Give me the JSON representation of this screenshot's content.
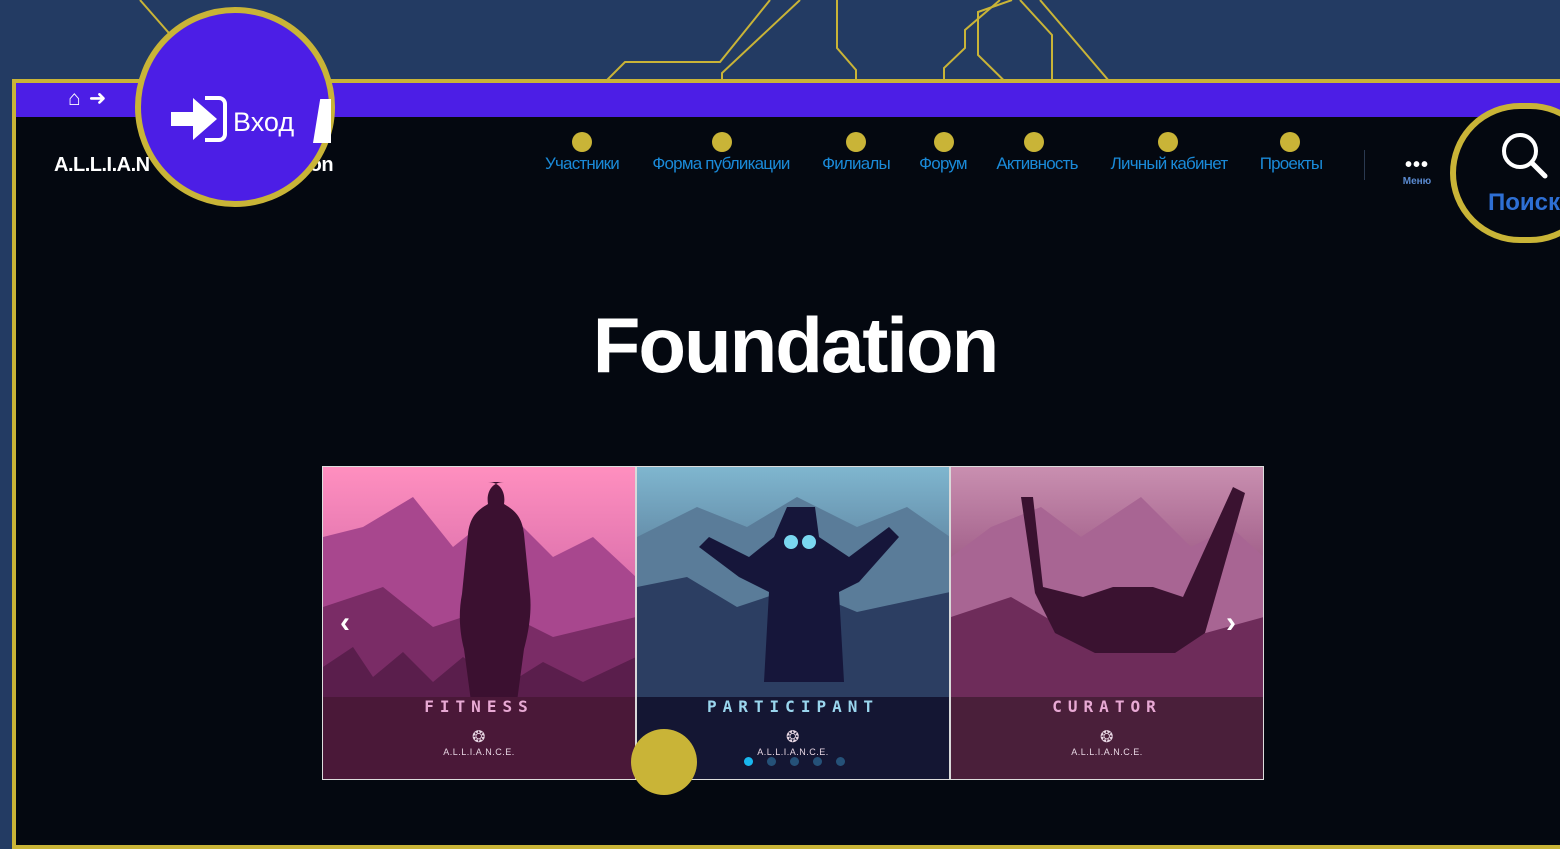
{
  "topbar": {
    "home_icon": "home-icon",
    "login_icon": "sign-in-icon"
  },
  "header": {
    "brand_prefix": "A.L.L.I.A.N",
    "brand_suffix": "on"
  },
  "nav": {
    "items": [
      {
        "label": "Участники"
      },
      {
        "label": "Форма публикации"
      },
      {
        "label": "Филиалы"
      },
      {
        "label": "Форум"
      },
      {
        "label": "Активность"
      },
      {
        "label": "Личный кабинет"
      },
      {
        "label": "Проекты"
      }
    ],
    "menu_dots": "•••",
    "menu_label": "Меню"
  },
  "callouts": {
    "login_label": "Вход",
    "search_label": "Поиск"
  },
  "main": {
    "title": "Foundation"
  },
  "carousel": {
    "slides": [
      {
        "title": "FITNESS",
        "logo": "A.L.L.I.A.N.C.E."
      },
      {
        "title": "PARTICIPANT",
        "logo": "A.L.L.I.A.N.C.E."
      },
      {
        "title": "CURATOR",
        "logo": "A.L.L.I.A.N.C.E."
      }
    ],
    "prev": "‹",
    "next": "›",
    "active_dot": 1,
    "dot_count": 5
  },
  "colors": {
    "accent_yellow": "#c9b437",
    "topbar_purple": "#4c1ee6",
    "nav_link": "#1a8ad8",
    "page_bg": "#040810",
    "outer_bg": "#233b63"
  }
}
